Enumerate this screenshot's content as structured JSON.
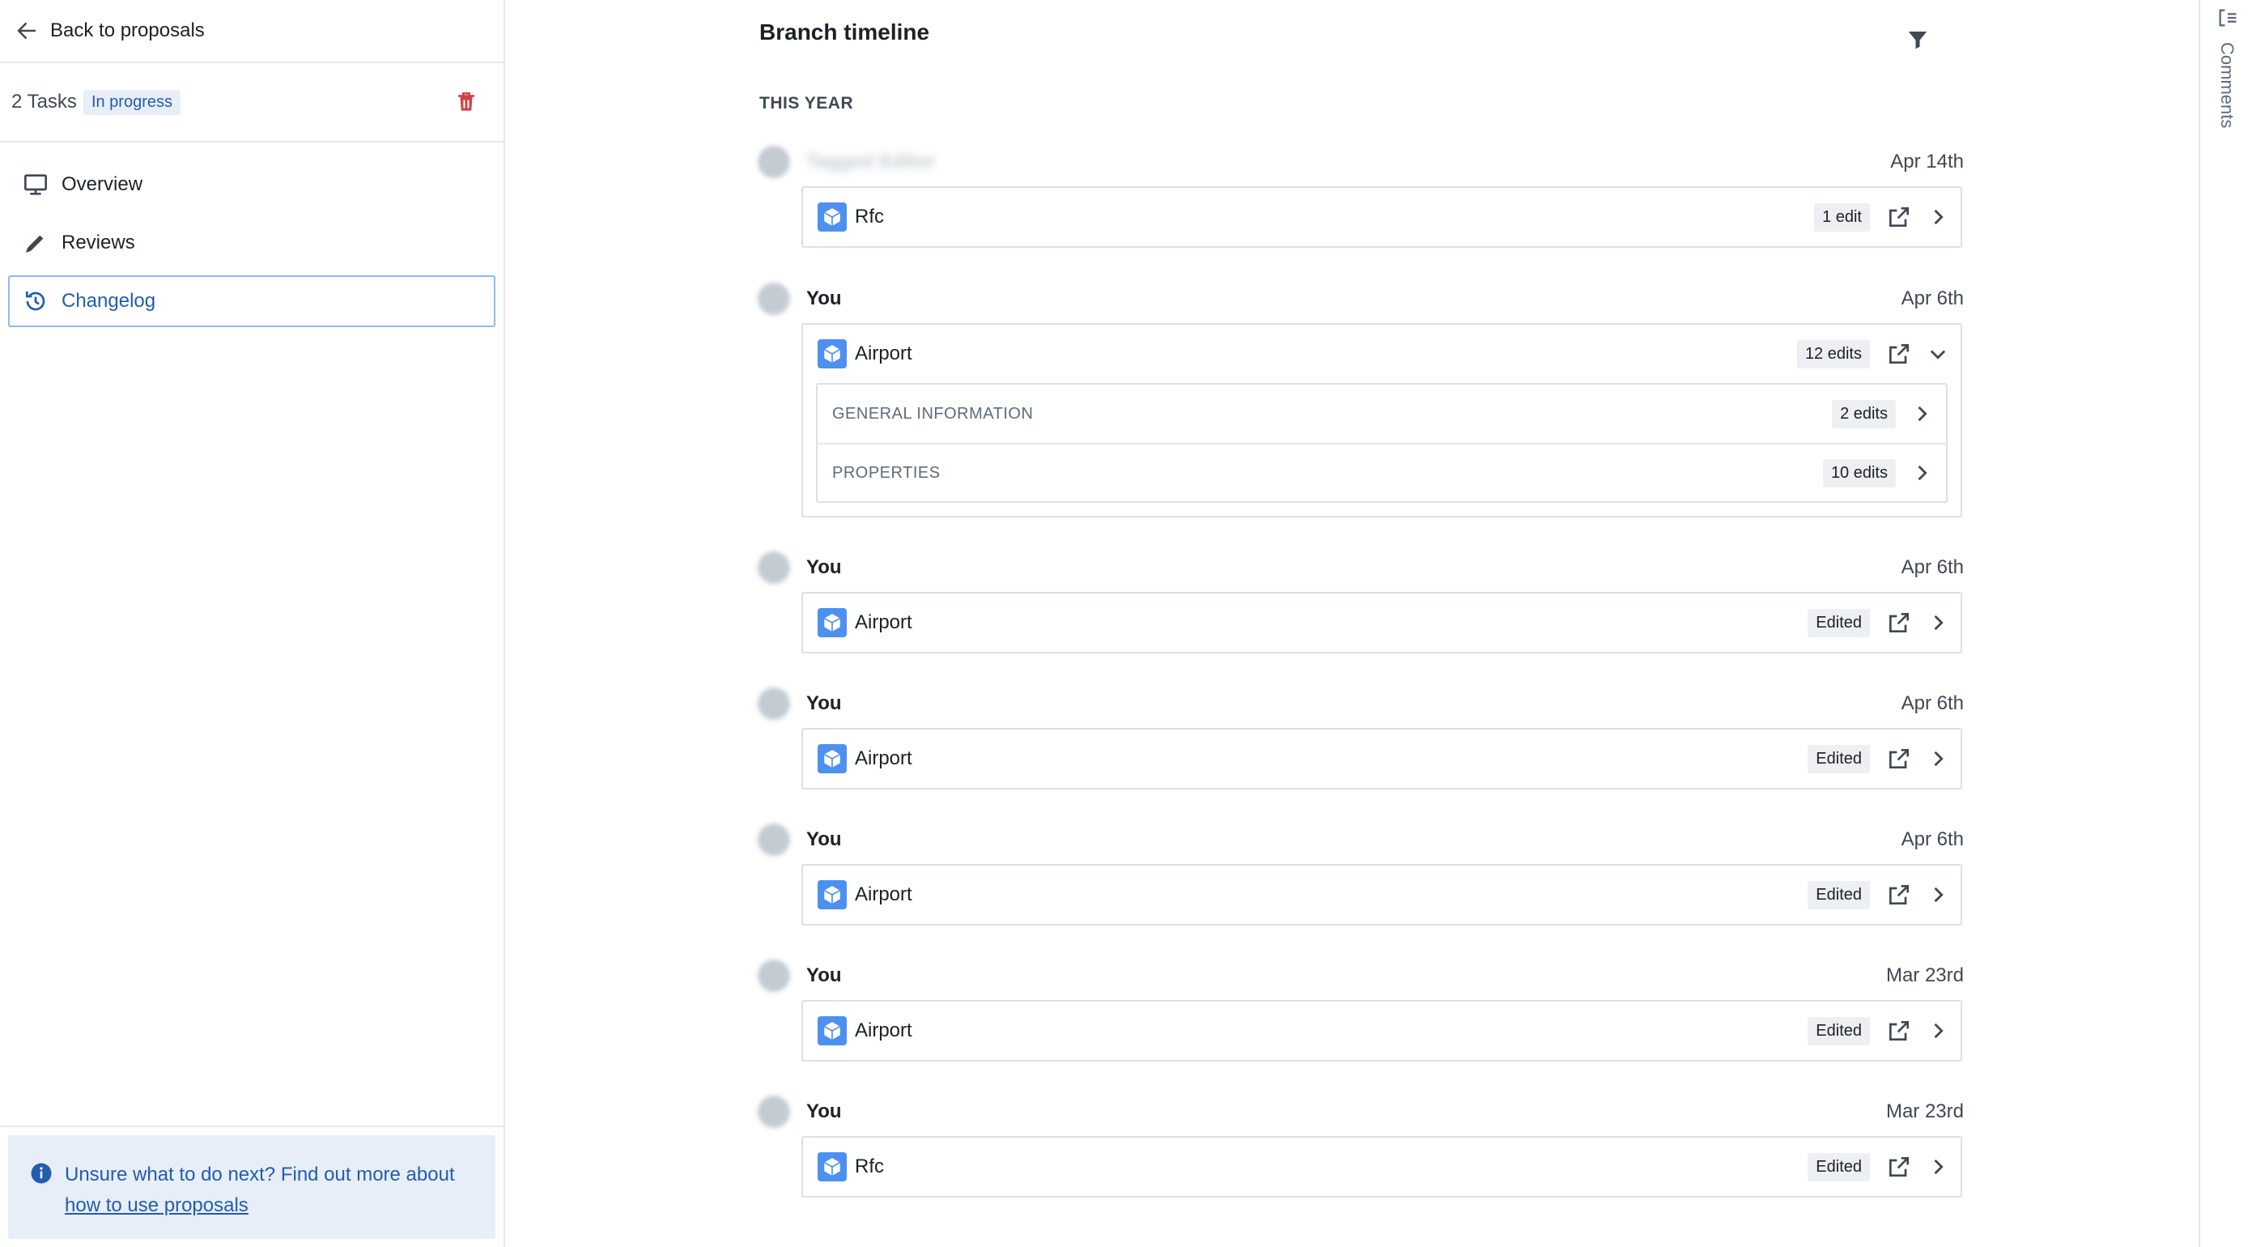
{
  "sidebar": {
    "back_label": "Back to proposals",
    "tasks_count": "2 Tasks",
    "status_badge": "In progress",
    "nav": [
      {
        "label": "Overview",
        "icon": "desktop-icon"
      },
      {
        "label": "Reviews",
        "icon": "pencil-icon"
      },
      {
        "label": "Changelog",
        "icon": "history-icon",
        "active": true
      }
    ],
    "help": {
      "text": "Unsure what to do next? Find out more about",
      "link": "how to use proposals"
    }
  },
  "timeline": {
    "title": "Branch timeline",
    "section": "THIS YEAR",
    "entries": [
      {
        "author": "Tagged Editor",
        "author_blurred": true,
        "date": "Apr 14th",
        "object": "Rfc",
        "edits": "1 edit"
      },
      {
        "author": "You",
        "date": "Apr 6th",
        "object": "Airport",
        "edits": "12 edits",
        "expanded": true,
        "groups": [
          {
            "label": "GENERAL INFORMATION",
            "edits": "2 edits"
          },
          {
            "label": "PROPERTIES",
            "edits": "10 edits"
          }
        ]
      },
      {
        "author": "You",
        "date": "Apr 6th",
        "object": "Airport",
        "edits": "Edited"
      },
      {
        "author": "You",
        "date": "Apr 6th",
        "object": "Airport",
        "edits": "Edited"
      },
      {
        "author": "You",
        "date": "Apr 6th",
        "object": "Airport",
        "edits": "Edited"
      },
      {
        "author": "You",
        "date": "Mar 23rd",
        "object": "Airport",
        "edits": "Edited"
      },
      {
        "author": "You",
        "date": "Mar 23rd",
        "object": "Rfc",
        "edits": "Edited"
      }
    ]
  },
  "comments_rail": {
    "label": "Comments"
  },
  "colors": {
    "accent": "#215db0",
    "badge_bg": "#e8eef7",
    "object_icon": "#4c90f0",
    "danger": "#cd4246"
  }
}
